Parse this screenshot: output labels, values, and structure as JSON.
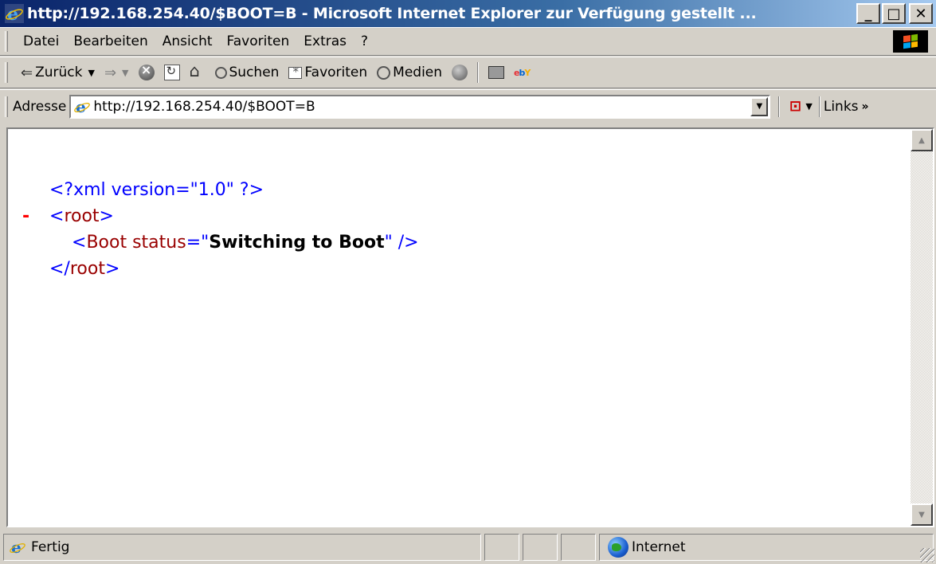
{
  "window": {
    "title": "http://192.168.254.40/$BOOT=B - Microsoft Internet Explorer  zur Verfügung gestellt ...",
    "minimize_label": "_",
    "maximize_label": "□",
    "close_label": "✕"
  },
  "menu": {
    "items": [
      {
        "label": "Datei",
        "access": "D"
      },
      {
        "label": "Bearbeiten",
        "access": "B"
      },
      {
        "label": "Ansicht",
        "access": "A"
      },
      {
        "label": "Favoriten",
        "access": "F"
      },
      {
        "label": "Extras",
        "access": "x"
      },
      {
        "label": "?",
        "access": "?"
      }
    ]
  },
  "toolbar": {
    "back_label": "Zurück",
    "search_label": "Suchen",
    "favorites_label": "Favoriten",
    "media_label": "Medien"
  },
  "address": {
    "label": "Adresse",
    "url": "http://192.168.254.40/$BOOT=B",
    "links_label": "Links"
  },
  "document": {
    "xml_decl": "<?xml version=\"1.0\" ?>",
    "minus": "-",
    "root_open": "root",
    "boot_tag": "Boot",
    "boot_attr": "status",
    "boot_value": "Switching to Boot",
    "root_close": "root"
  },
  "status": {
    "text": "Fertig",
    "zone": "Internet"
  },
  "colors": {
    "title_gradient_start": "#0a246a",
    "title_gradient_end": "#a6caf0",
    "chrome": "#d4d0c8",
    "xml_markup": "#0000ff",
    "xml_tag": "#990000",
    "xml_minus": "#ff0000"
  },
  "icons": [
    "ie-logo-icon",
    "windows-logo-icon",
    "back-arrow-icon",
    "forward-arrow-icon",
    "stop-icon",
    "refresh-icon",
    "home-icon",
    "search-icon",
    "favorites-icon",
    "media-icon",
    "history-icon",
    "print-icon",
    "ebay-icon",
    "pdf-icon",
    "globe-icon"
  ]
}
